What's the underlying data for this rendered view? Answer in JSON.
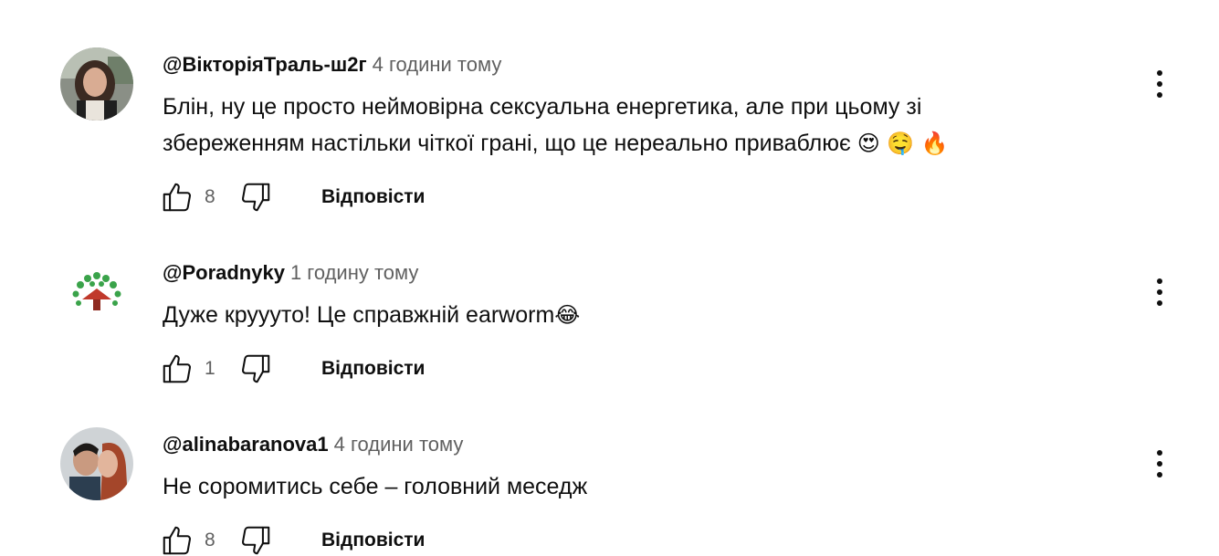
{
  "comments": [
    {
      "author": "@ВікторіяТраль-ш2г",
      "time": "4 години тому",
      "text_line1": "Блін, ну це просто неймовірна сексуальна енергетика, але при цьому зі",
      "text_line2": "збереженням настільки чіткої грані, що це нереально приваблює",
      "emojis": "😍 🤤 🔥",
      "likes": "8",
      "reply": "Відповісти"
    },
    {
      "author": "@Poradnyky",
      "time": "1 годину тому",
      "text_line1": "Дуже круууто! Це справжній earworm",
      "emojis": "😂",
      "likes": "1",
      "reply": "Відповісти"
    },
    {
      "author": "@alinabaranova1",
      "time": "4 години тому",
      "text_line1": "Не соромитись себе – головний меседж",
      "likes": "8",
      "reply": "Відповісти"
    }
  ],
  "icons": {
    "like": "thumb-up-icon",
    "dislike": "thumb-down-icon",
    "menu": "more-vert-icon"
  }
}
